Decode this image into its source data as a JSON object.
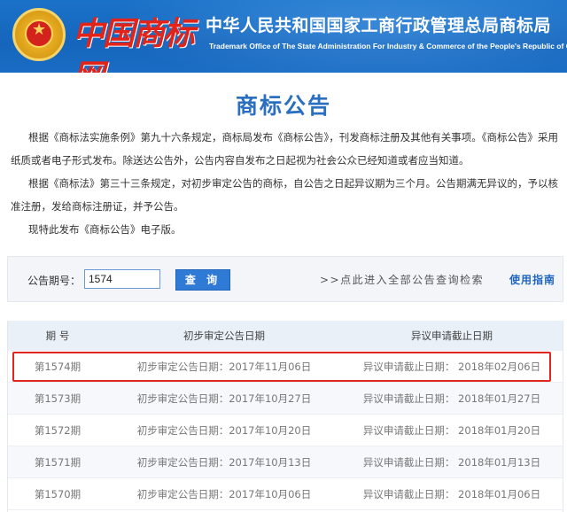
{
  "header": {
    "logo_text": "中国商标网",
    "title": "中华人民共和国国家工商行政管理总局商标局",
    "subtitle": "Trademark Office of The State Administration For Industry & Commerce of the People's Republic of China"
  },
  "page_title": "商标公告",
  "intro": {
    "paragraphs": [
      "根据《商标法实施条例》第九十六条规定，商标局发布《商标公告》，刊发商标注册及其他有关事项。《商标公告》采用纸质或者电子形式发布。除送达公告外，公告内容自发布之日起视为社会公众已经知道或者应当知道。",
      "根据《商标法》第三十三条规定，对初步审定公告的商标，自公告之日起异议期为三个月。公告期满无异议的，予以核准注册，发给商标注册证，并予公告。",
      "现特此发布《商标公告》电子版。"
    ]
  },
  "search": {
    "label": "公告期号：",
    "value": "1574",
    "button_label": "查 询",
    "all_link": ">>点此进入全部公告查询检索",
    "guide_link": "使用指南"
  },
  "table": {
    "headers": [
      "期 号",
      "初步审定公告日期",
      "异议申请截止日期"
    ],
    "rows": [
      {
        "issue": "第1574期",
        "prelim": "初步审定公告日期：2017年11月06日",
        "deadline": "异议申请截止日期： 2018年02月06日"
      },
      {
        "issue": "第1573期",
        "prelim": "初步审定公告日期：2017年10月27日",
        "deadline": "异议申请截止日期： 2018年01月27日"
      },
      {
        "issue": "第1572期",
        "prelim": "初步审定公告日期：2017年10月20日",
        "deadline": "异议申请截止日期： 2018年01月20日"
      },
      {
        "issue": "第1571期",
        "prelim": "初步审定公告日期：2017年10月13日",
        "deadline": "异议申请截止日期： 2018年01月13日"
      },
      {
        "issue": "第1570期",
        "prelim": "初步审定公告日期：2017年10月06日",
        "deadline": "异议申请截止日期： 2018年01月06日"
      }
    ]
  },
  "colors": {
    "header_blue": "#1565bc",
    "title_blue": "#2a6fc0",
    "highlight_red": "#e0261f",
    "button_blue": "#2f7ad4"
  },
  "icons": {
    "emblem": "national-emblem-icon"
  }
}
